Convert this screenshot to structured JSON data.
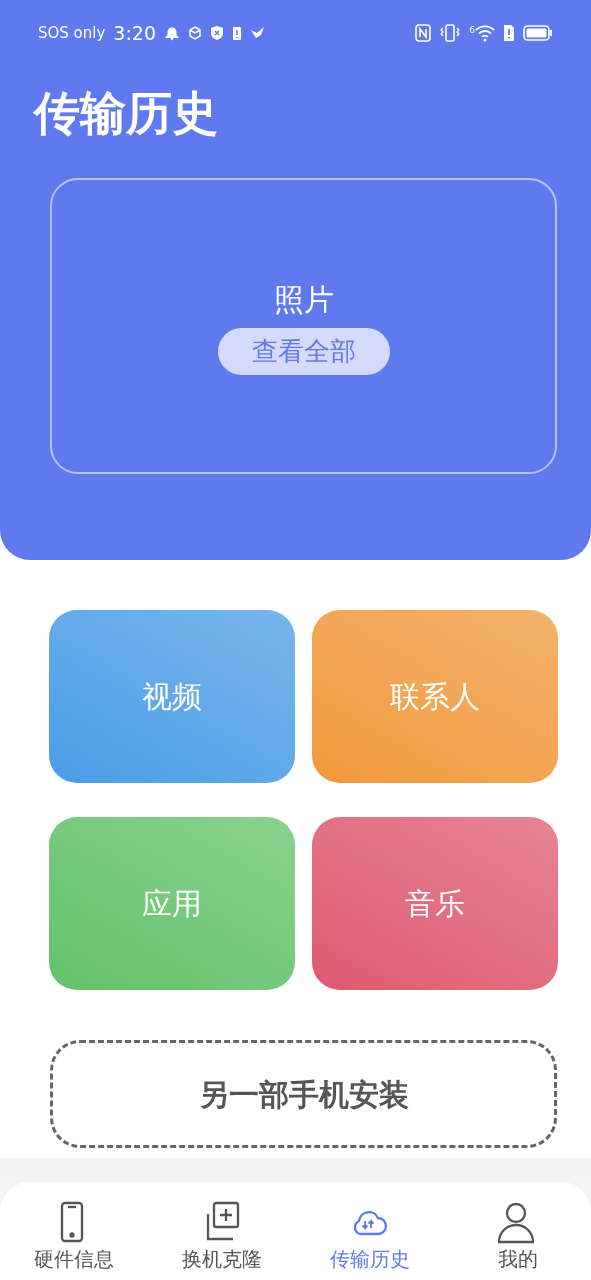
{
  "status_bar": {
    "carrier": "SOS only",
    "time": "3:20",
    "wifi_badge": "6"
  },
  "title": "传输历史",
  "photos": {
    "label": "照片",
    "button": "查看全部"
  },
  "tiles": [
    {
      "label": "视频",
      "color": "#4a9de6"
    },
    {
      "label": "联系人",
      "color": "#f0993a"
    },
    {
      "label": "应用",
      "color": "#62c26a"
    },
    {
      "label": "音乐",
      "color": "#de5a70"
    }
  ],
  "install_button": "另一部手机安装",
  "tabs": [
    {
      "label": "硬件信息",
      "kind": "phone",
      "selected": false
    },
    {
      "label": "换机克隆",
      "kind": "clone",
      "selected": false
    },
    {
      "label": "传输历史",
      "kind": "cloud",
      "selected": true
    },
    {
      "label": "我的",
      "kind": "person",
      "selected": false
    }
  ]
}
